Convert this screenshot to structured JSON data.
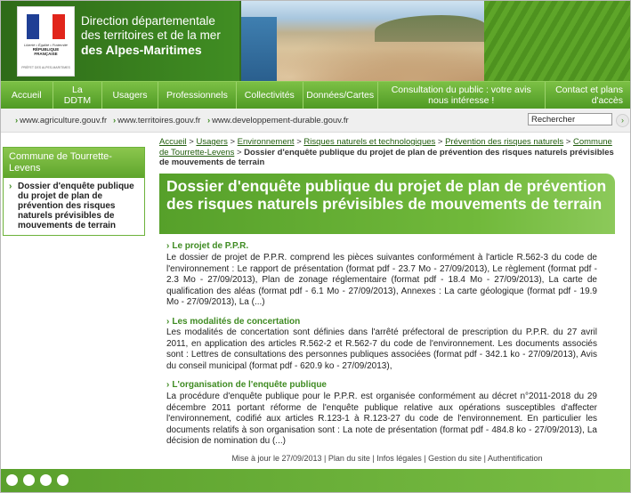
{
  "header": {
    "title_line1": "Direction départementale",
    "title_line2": "des territoires et de la mer",
    "title_line3": "des Alpes-Maritimes",
    "logo": {
      "motto": "Liberté • Égalité • Fraternité",
      "country": "RÉPUBLIQUE FRANÇAISE",
      "prefecture": "PRÉFET DES ALPES-MARITIMES"
    }
  },
  "nav": {
    "items": [
      {
        "label": "Accueil"
      },
      {
        "label": "La DDTM"
      },
      {
        "label": "Usagers"
      },
      {
        "label": "Professionnels"
      },
      {
        "label": "Collectivités"
      },
      {
        "label": "Données/Cartes"
      },
      {
        "label": "Consultation du public : votre avis nous intéresse !"
      },
      {
        "label": "Contact et plans d'accès"
      }
    ]
  },
  "links": {
    "items": [
      "www.agriculture.gouv.fr",
      "www.territoires.gouv.fr",
      "www.developpement-durable.gouv.fr"
    ],
    "search_value": "Rechercher"
  },
  "sidebar": {
    "heading": "Commune de Tourrette-Levens",
    "item": "Dossier d'enquête publique du projet de plan de prévention des risques naturels prévisibles de mouvements de terrain"
  },
  "breadcrumb": {
    "items": [
      "Accueil",
      "Usagers",
      "Environnement",
      "Risques naturels et technologiques",
      "Prévention des risques naturels",
      "Commune de Tourrette-Levens"
    ],
    "current": "Dossier d'enquête publique du projet de plan de prévention des risques naturels prévisibles de mouvements de terrain"
  },
  "page": {
    "title": "Dossier d'enquête publique du projet de plan de prévention des risques naturels prévisibles de mouvements de terrain",
    "sections": [
      {
        "title": "Le projet de P.P.R.",
        "body": "Le dossier de projet de P.P.R. comprend les pièces suivantes conformément à l'article R.562-3 du code de l'environnement : Le rapport de présentation (format pdf - 23.7 Mo - 27/09/2013), Le règlement (format pdf - 2.3 Mo - 27/09/2013), Plan de zonage réglementaire (format pdf - 18.4 Mo - 27/09/2013), La carte de qualification des aléas (format pdf - 6.1 Mo - 27/09/2013), Annexes : La carte géologique (format pdf - 19.9 Mo - 27/09/2013), La (...)"
      },
      {
        "title": "Les modalités de concertation",
        "body": "Les modalités de concertation sont définies dans l'arrêté préfectoral de prescription du P.P.R. du 27 avril 2011, en application des articles R.562-2 et R.562-7 du code de l'environnement. Les documents associés sont : Lettres de consultations des personnes publiques associées (format pdf - 342.1 ko - 27/09/2013), Avis du conseil municipal (format pdf - 620.9 ko - 27/09/2013),"
      },
      {
        "title": "L'organisation de l'enquête publique",
        "body": "La procédure d'enquête publique pour le P.P.R. est organisée conformément au décret n°2011-2018 du 29 décembre 2011 portant réforme de l'enquête publique relative aux opérations susceptibles d'affecter l'environnement, codifié aux articles R.123-1 à R.123-27 du code de l'environnement. En particulier les documents relatifs à son organisation sont : La note de présentation (format pdf - 484.8 ko - 27/09/2013), La décision de nomination du (...)"
      }
    ]
  },
  "footer": {
    "updated": "Mise à jour le 27/09/2013",
    "links": [
      "Plan du site",
      "Infos légales",
      "Gestion du site",
      "Authentification"
    ]
  }
}
